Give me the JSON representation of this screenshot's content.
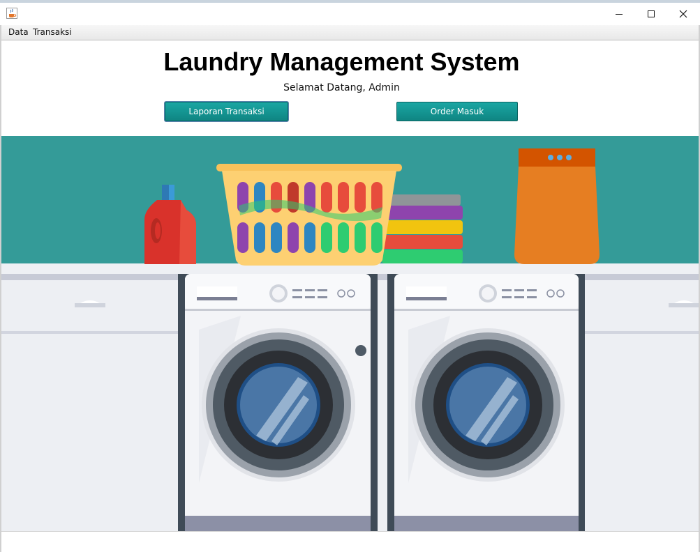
{
  "window": {
    "icon": "java-cup-icon",
    "controls": [
      "minimize-icon",
      "maximize-icon",
      "close-icon"
    ]
  },
  "menubar": {
    "items": [
      {
        "label": "Data"
      },
      {
        "label": "Transaksi"
      }
    ]
  },
  "header": {
    "title": "Laundry Management System",
    "welcome": "Selamat Datang, Admin"
  },
  "buttons": {
    "report_label": "Laporan Transaksi",
    "order_label": "Order Masuk"
  },
  "colors": {
    "teal_wall": "#349b98",
    "button_teal": "#139894",
    "detergent_red": "#d9322b",
    "basket_yellow": "#f8c25b",
    "hamper_orange": "#e67e22"
  }
}
